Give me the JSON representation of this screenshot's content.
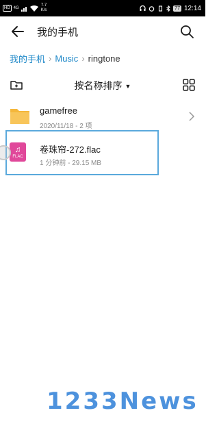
{
  "statusbar": {
    "carrier_badge": "HD",
    "signal": "4G",
    "speed": "7.7",
    "speed_unit": "K/s",
    "battery": "77",
    "time": "12:14"
  },
  "header": {
    "title": "我的手机",
    "back_icon": "back-arrow-icon",
    "search_icon": "search-icon"
  },
  "breadcrumb": {
    "items": [
      "我的手机",
      "Music",
      "ringtone"
    ]
  },
  "toolbar": {
    "sort_label": "按名称排序",
    "new_folder_icon": "new-folder-icon",
    "grid_icon": "grid-view-icon"
  },
  "files": [
    {
      "name": "gamefree",
      "meta": "2020/11/18 - 2 项",
      "type": "folder"
    },
    {
      "name": "卷珠帘-272.flac",
      "meta": "1 分钟前 - 29.15 MB",
      "type": "flac",
      "badge": "FLAC"
    }
  ],
  "watermark": "1233News",
  "colors": {
    "accent": "#1e88c8",
    "folder": "#f5b73b",
    "flac": "#e0489a",
    "selection": "#5aa9dc"
  }
}
